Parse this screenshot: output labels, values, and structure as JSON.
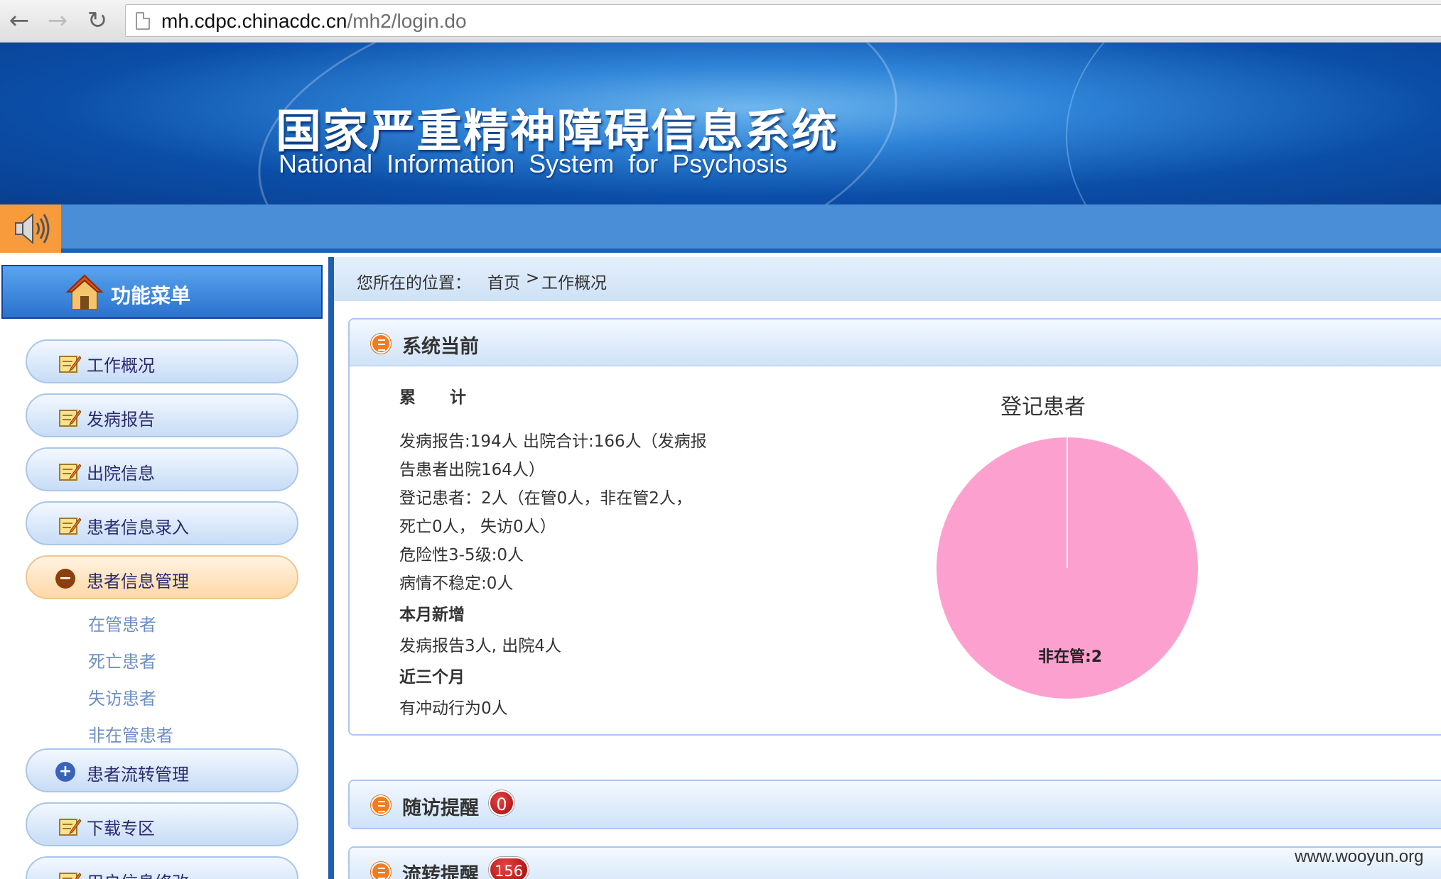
{
  "browser": {
    "url_host": "mh.cdpc.chinacdc.cn",
    "url_path": "/mh2/login.do"
  },
  "banner": {
    "title_cn": "国家严重精神障碍信息系统",
    "title_en": "National Information System for Psychosis"
  },
  "sidebar": {
    "header": "功能菜单",
    "items": [
      {
        "label": "工作概况",
        "icon": "edit-note-icon"
      },
      {
        "label": "发病报告",
        "icon": "edit-note-icon"
      },
      {
        "label": "出院信息",
        "icon": "edit-note-icon"
      },
      {
        "label": "患者信息录入",
        "icon": "edit-note-icon"
      },
      {
        "label": "患者信息管理",
        "icon": "minus-circle-icon"
      },
      {
        "label": "患者流转管理",
        "icon": "plus-circle-icon"
      },
      {
        "label": "下载专区",
        "icon": "edit-note-icon"
      },
      {
        "label": "用户信息修改",
        "icon": "edit-note-icon"
      }
    ],
    "subitems": [
      "在管患者",
      "死亡患者",
      "失访患者",
      "非在管患者"
    ]
  },
  "breadcrumb": {
    "label": "您所在的位置：",
    "home": "首页",
    "sep": ">",
    "current": "工作概况"
  },
  "panels": {
    "system": {
      "title": "系统当前",
      "cumulative_head": "累 计",
      "lines": [
        "发病报告:194人  出院合计:166人（发病报",
        "告患者出院164人）",
        "登记患者：2人（在管0人，非在管2人，",
        "死亡0人，  失访0人）",
        "危险性3-5级:0人",
        "病情不稳定:0人"
      ],
      "month_head": "本月新增",
      "month_line": " 发病报告3人, 出院4人",
      "quarter_head": "近三个月",
      "quarter_line": " 有冲动行为0人"
    },
    "followup": {
      "title": "随访提醒",
      "badge": "0"
    },
    "transfer": {
      "title": "流转提醒",
      "badge": "156"
    }
  },
  "chart_data": {
    "type": "pie",
    "title": "登记患者",
    "categories": [
      "非在管"
    ],
    "values": [
      2
    ],
    "labels": [
      "非在管:2"
    ],
    "colors": [
      "#fca1cf"
    ]
  },
  "watermark": "www.wooyun.org"
}
